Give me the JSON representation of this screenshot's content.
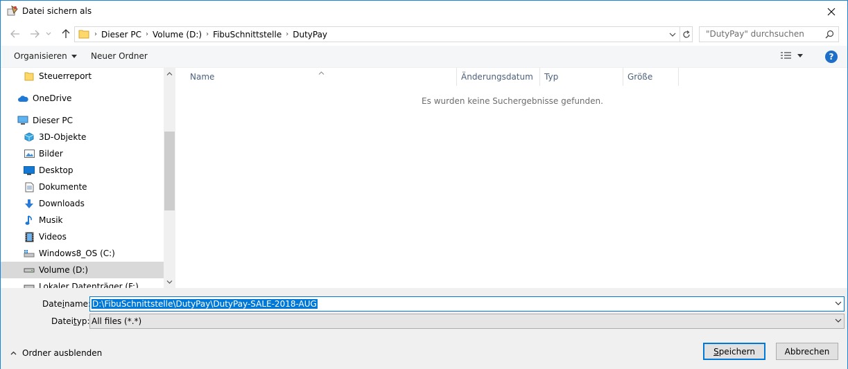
{
  "window": {
    "title": "Datei sichern als",
    "close_glyph": "✕"
  },
  "address": {
    "crumbs": [
      "Dieser PC",
      "Volume (D:)",
      "FibuSchnittstelle",
      "DutyPay"
    ],
    "search_placeholder": "\"DutyPay\" durchsuchen"
  },
  "toolbar": {
    "organize_label": "Organisieren",
    "new_folder_label": "Neuer Ordner",
    "help_label": "?"
  },
  "navpane": {
    "items": [
      {
        "label": "Steuerreport",
        "icon": "folder-icon"
      },
      {
        "label": "OneDrive",
        "icon": "cloud-icon"
      },
      {
        "label": "Dieser PC",
        "icon": "pc-icon"
      },
      {
        "label": "3D-Objekte",
        "icon": "cube-icon"
      },
      {
        "label": "Bilder",
        "icon": "pictures-icon"
      },
      {
        "label": "Desktop",
        "icon": "desktop-icon"
      },
      {
        "label": "Dokumente",
        "icon": "documents-icon"
      },
      {
        "label": "Downloads",
        "icon": "download-icon"
      },
      {
        "label": "Musik",
        "icon": "music-icon"
      },
      {
        "label": "Videos",
        "icon": "video-icon"
      },
      {
        "label": "Windows8_OS (C:)",
        "icon": "drive-c-icon"
      },
      {
        "label": "Volume (D:)",
        "icon": "drive-icon",
        "selected": true
      },
      {
        "label": "Lokaler Datenträger (F:)",
        "icon": "drive-icon"
      }
    ]
  },
  "filelist": {
    "columns": [
      "Name",
      "Änderungsdatum",
      "Typ",
      "Größe"
    ],
    "empty_message": "Es wurden keine Suchergebnisse gefunden."
  },
  "form": {
    "filename_label_pre": "Date",
    "filename_label_u": "i",
    "filename_label_post": "name:",
    "filename_value": "D:\\FibuSchnittstelle\\DutyPay\\DutyPay-SALE-2018-AUG",
    "filetype_label_pre": "Datei",
    "filetype_label_u": "t",
    "filetype_label_post": "yp:",
    "filetype_value": "All files (*.*)",
    "hide_folders_label": "Ordner ausblenden",
    "save_label_u": "S",
    "save_label_rest": "peichern",
    "cancel_label": "Abbrechen"
  },
  "colors": {
    "accent": "#0078d7",
    "selection_bg": "#d9d9d9",
    "toolbar_bg": "#f5f6f7",
    "bottom_bg": "#f0f0f0"
  }
}
